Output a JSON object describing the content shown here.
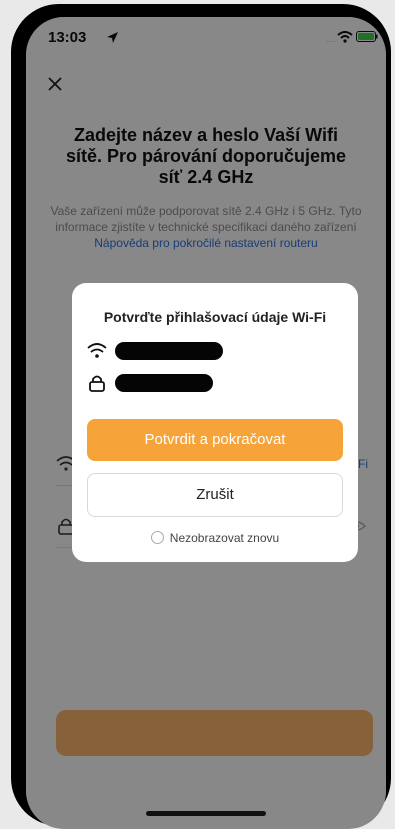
{
  "status_bar": {
    "time": "13:03"
  },
  "background": {
    "title": "Zadejte název a heslo Vaší Wifi sítě. Pro párování doporučujeme síť 2.4 GHz",
    "subtitle_text": "Vaše zařízení může podporovat sítě 2.4 GHz i 5 GHz. Tyto informace zjistíte v technické specifikaci daného zařízení ",
    "subtitle_link": "Nápověda pro pokročilé nastavení routeru",
    "wifi_row_suffix": "-Fi"
  },
  "modal": {
    "title": "Potvrďte přihlašovací údaje Wi-Fi",
    "confirm_label": "Potvrdit a pokračovat",
    "cancel_label": "Zrušit",
    "dont_show_label": "Nezobrazovat znovu"
  },
  "colors": {
    "accent": "#f6a43a",
    "link": "#2f6fd6",
    "overlay": "rgba(0,0,0,0.45)"
  },
  "icons": [
    "location-arrow-icon",
    "wifi-icon",
    "battery-icon",
    "close-icon",
    "lock-icon",
    "eye-icon"
  ]
}
